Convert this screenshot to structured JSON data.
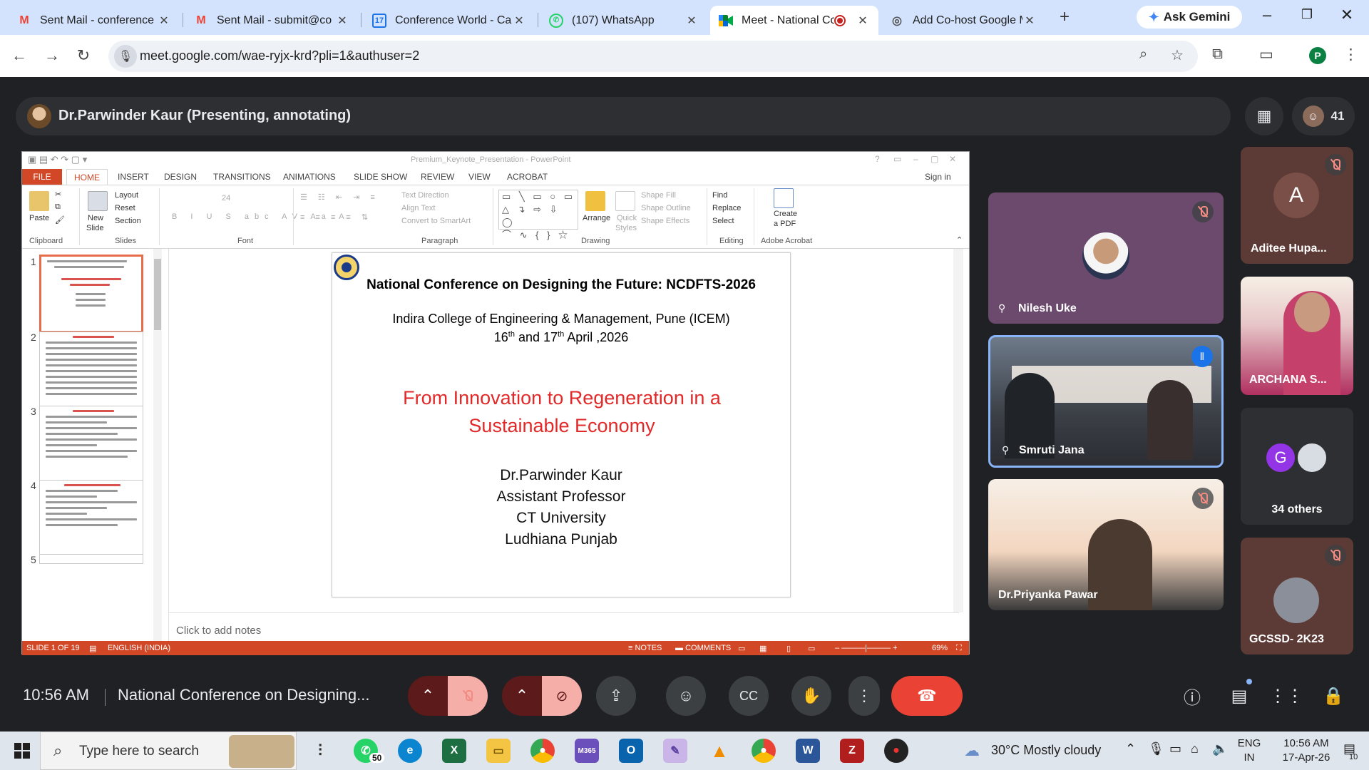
{
  "browser": {
    "tabs": [
      {
        "title": "Sent Mail - conference",
        "icon": "gmail-icon",
        "active": false
      },
      {
        "title": "Sent Mail - submit@co",
        "icon": "gmail-icon",
        "active": false
      },
      {
        "title": "Conference World - Cal",
        "icon": "calendar-icon",
        "active": false
      },
      {
        "title": "(107) WhatsApp",
        "icon": "whatsapp-icon",
        "active": false
      },
      {
        "title": "Meet - National Co",
        "icon": "meet-icon",
        "active": true,
        "recording": true
      },
      {
        "title": "Add Co-host Google M",
        "icon": "web-icon",
        "active": false
      }
    ],
    "gemini_label": "Ask Gemini",
    "url": "meet.google.com/wae-ryjx-krd?pli=1&authuser=2",
    "profile_initial": "P"
  },
  "meet": {
    "presenter_label": "Dr.Parwinder Kaur (Presenting, annotating)",
    "participant_count": "41",
    "clock": "10:56 AM",
    "meeting_title": "National Conference on Designing...",
    "tiles": {
      "nilesh": "Nilesh Uke",
      "smruti": "Smruti Jana",
      "priyanka": "Dr.Priyanka Pawar",
      "aditee": "Aditee Hupa...",
      "aditee_initial": "A",
      "archana": "ARCHANA S...",
      "others": "34 others",
      "others_initial": "G",
      "gcssd": "GCSSD- 2K23"
    }
  },
  "powerpoint": {
    "window_title": "Premium_Keynote_Presentation - PowerPoint",
    "tabs": [
      "FILE",
      "HOME",
      "INSERT",
      "DESIGN",
      "TRANSITIONS",
      "ANIMATIONS",
      "SLIDE SHOW",
      "REVIEW",
      "VIEW",
      "ACROBAT"
    ],
    "sign_in": "Sign in",
    "ribbon": {
      "paste": "Paste",
      "new_slide": "New",
      "new_slide_2": "Slide",
      "layout": "Layout",
      "reset": "Reset",
      "section": "Section",
      "font_size": "24",
      "text_direction": "Text Direction",
      "align_text": "Align Text",
      "convert_smartart": "Convert to SmartArt",
      "arrange": "Arrange",
      "quick_styles": "Quick",
      "quick_styles_2": "Styles",
      "shape_fill": "Shape Fill",
      "shape_outline": "Shape Outline",
      "shape_effects": "Shape Effects",
      "find": "Find",
      "replace": "Replace",
      "select": "Select",
      "create_pdf": "Create",
      "create_pdf_2": "a PDF",
      "groups": {
        "clipboard": "Clipboard",
        "slides": "Slides",
        "font": "Font",
        "paragraph": "Paragraph",
        "drawing": "Drawing",
        "editing": "Editing",
        "acrobat": "Adobe Acrobat"
      }
    },
    "thumb_numbers": [
      "1",
      "2",
      "3",
      "4",
      "5"
    ],
    "slide": {
      "title": "National Conference on Designing the Future: NCDFTS-2026",
      "institute": "Indira College of Engineering & Management, Pune (ICEM)",
      "date_day1": "16",
      "date_sup1": "th",
      "date_and": " and 17",
      "date_sup2": "th",
      "date_rest": " April ,2026",
      "theme": "From Innovation to Regeneration in a Sustainable Economy",
      "author_name": "Dr.Parwinder Kaur",
      "author_role": "Assistant Professor",
      "author_uni": "CT University",
      "author_city": "Ludhiana Punjab"
    },
    "notes_placeholder": "Click to add notes",
    "status": {
      "slide": "SLIDE 1 OF 19",
      "language": "ENGLISH (INDIA)",
      "notes": "NOTES",
      "comments": "COMMENTS",
      "zoom": "69%"
    }
  },
  "taskbar": {
    "search_placeholder": "Type here to search",
    "whatsapp_badge": "50",
    "weather": "30°C  Mostly cloudy",
    "lang_top": "ENG",
    "lang_bottom": "IN",
    "time": "10:56 AM",
    "date": "17-Apr-26",
    "notif_count": "10"
  },
  "colors": {
    "ppt_accent": "#d24726",
    "meet_bg": "#202124",
    "end_call": "#ea4335",
    "slide_theme_red": "#e12929"
  }
}
